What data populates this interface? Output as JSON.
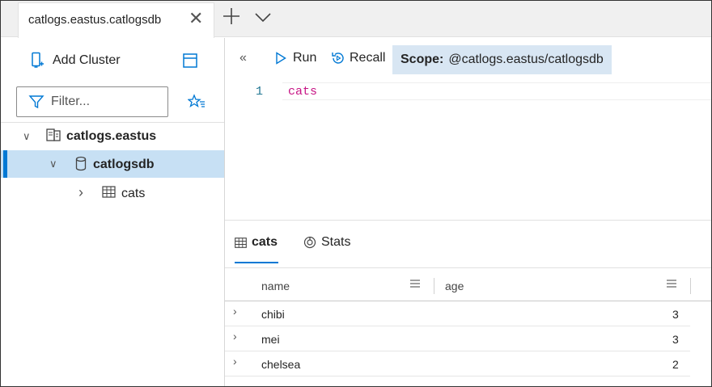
{
  "tab": {
    "title": "catlogs.eastus.catlogsdb",
    "close_glyph": "✕"
  },
  "left_toolbar": {
    "add_cluster_label": "Add Cluster"
  },
  "filter": {
    "placeholder": "Filter..."
  },
  "tree": {
    "cluster": {
      "label": "catlogs.eastus",
      "chevron": "∨"
    },
    "database": {
      "label": "catlogsdb",
      "chevron": "∨"
    },
    "table": {
      "label": "cats",
      "chevron": "›"
    }
  },
  "editor_toolbar": {
    "collapse_glyph": "«",
    "run_label": "Run",
    "recall_label": "Recall",
    "scope_label": "Scope:",
    "scope_value": "@catlogs.eastus/catlogsdb"
  },
  "editor": {
    "line_number": "1",
    "code": "cats"
  },
  "results": {
    "tabs": [
      {
        "label": "cats"
      },
      {
        "label": "Stats"
      }
    ],
    "columns": [
      "name",
      "age"
    ],
    "rows": [
      {
        "name": "chibi",
        "age": "3"
      },
      {
        "name": "mei",
        "age": "3"
      },
      {
        "name": "chelsea",
        "age": "2"
      }
    ],
    "expand_glyph": "›"
  },
  "colors": {
    "accent": "#0078d4",
    "selection": "#c7e0f4",
    "scope_bg": "#d8e6f3",
    "keyword": "#c71585"
  },
  "icons": [
    "add-cluster-icon",
    "collapse-panel-icon",
    "filter-icon",
    "favorites-icon",
    "cluster-icon",
    "database-icon",
    "table-icon",
    "run-icon",
    "recall-icon",
    "stats-icon",
    "column-menu-icon"
  ]
}
